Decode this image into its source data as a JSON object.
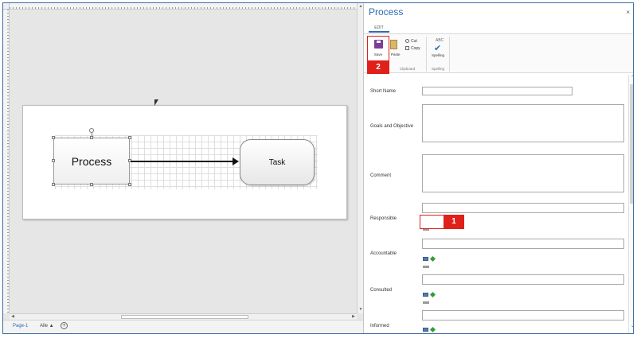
{
  "diagram": {
    "process_label": "Process",
    "task_label": "Task"
  },
  "page_bar": {
    "page_tab": "Page-1",
    "all_label": "Alle ▲",
    "add_symbol": "+"
  },
  "panel": {
    "title": "Process",
    "close": "×",
    "tab": "EDIT",
    "ribbon": {
      "save": "Save",
      "paste": "Paste",
      "cut": "Cut",
      "copy": "Copy",
      "clipboard_group": "Clipboard",
      "spelling": "Spelling",
      "spelling_group": "Spelling",
      "abc": "ABC"
    },
    "callout_save": "2",
    "callout_responsible": "1"
  },
  "form": {
    "short_name_label": "Short Name",
    "goals_label": "Goals and Objective",
    "comment_label": "Comment",
    "responsible_label": "Responsible",
    "accountable_label": "Accountable",
    "consulted_label": "Consulted",
    "informed_label": "Informed"
  },
  "colors": {
    "accent": "#2f6bb3",
    "callout": "#e0201a"
  }
}
